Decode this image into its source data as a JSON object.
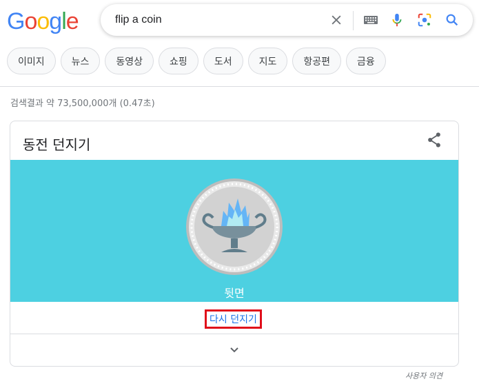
{
  "logo": {
    "letters": [
      "G",
      "o",
      "o",
      "g",
      "l",
      "e"
    ],
    "colors": [
      "#4285f4",
      "#ea4335",
      "#fbbc05",
      "#4285f4",
      "#34a853",
      "#ea4335"
    ]
  },
  "search": {
    "query": "flip a coin",
    "icons": [
      "close-icon",
      "keyboard-icon",
      "mic-icon",
      "lens-icon",
      "search-icon"
    ]
  },
  "chips": [
    "이미지",
    "뉴스",
    "동영상",
    "쇼핑",
    "도서",
    "지도",
    "항공편",
    "금융"
  ],
  "stats": "검색결과 약 73,500,000개 (0.47초)",
  "card": {
    "title": "동전 던지기",
    "result_label": "뒷면",
    "flip_again": "다시 던지기",
    "stage_color": "#4dd0e1",
    "highlight_color": "#e00d1a"
  },
  "feedback": "사용자 의견"
}
